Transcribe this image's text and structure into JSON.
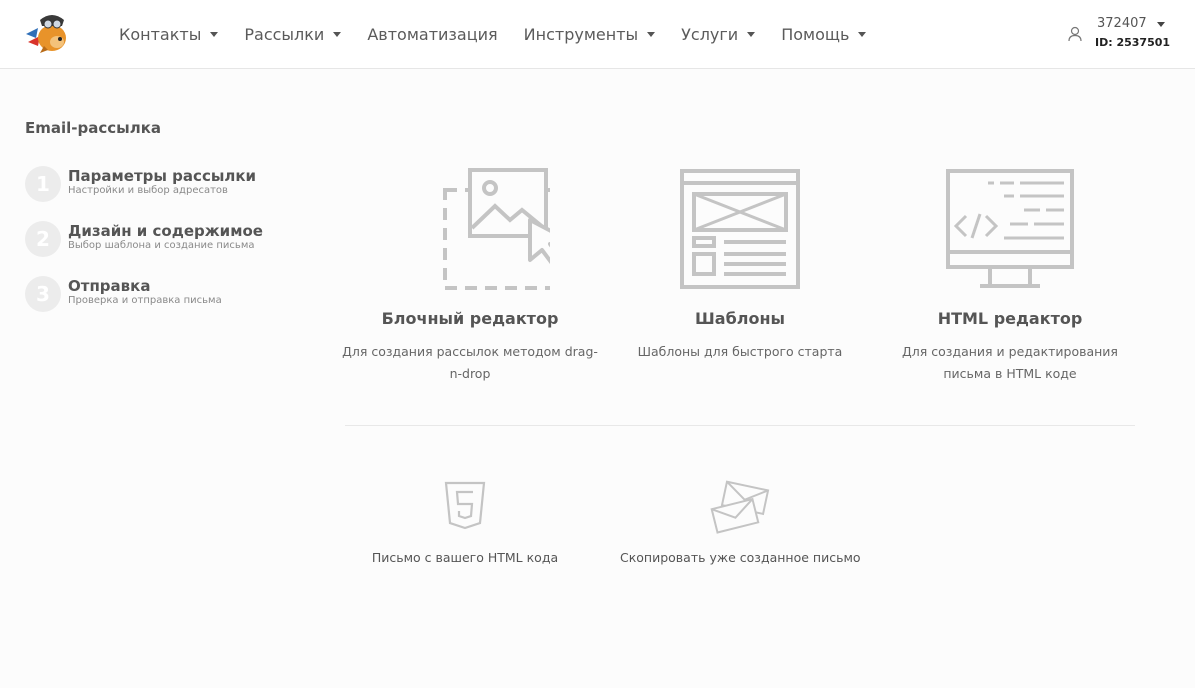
{
  "header": {
    "nav": [
      {
        "label": "Контакты",
        "has_dropdown": true
      },
      {
        "label": "Рассылки",
        "has_dropdown": true
      },
      {
        "label": "Автоматизация",
        "has_dropdown": false
      },
      {
        "label": "Инструменты",
        "has_dropdown": true
      },
      {
        "label": "Услуги",
        "has_dropdown": true
      },
      {
        "label": "Помощь",
        "has_dropdown": true
      }
    ],
    "user": {
      "number": "372407",
      "id": "ID: 2537501"
    }
  },
  "sidebar": {
    "title": "Email-рассылка",
    "steps": [
      {
        "num": "1",
        "title": "Параметры рассылки",
        "subtitle": "Настройки и выбор адресатов"
      },
      {
        "num": "2",
        "title": "Дизайн и содержимое",
        "subtitle": "Выбор шаблона и создание письма"
      },
      {
        "num": "3",
        "title": "Отправка",
        "subtitle": "Проверка и отправка письма"
      }
    ]
  },
  "options": [
    {
      "title": "Блочный редактор",
      "description": "Для создания рассылок методом drag-n-drop",
      "icon": "block-editor-icon"
    },
    {
      "title": "Шаблоны",
      "description": "Шаблоны для быстрого старта",
      "icon": "templates-icon"
    },
    {
      "title": "HTML редактор",
      "description": "Для создания и редактирования письма в HTML коде",
      "icon": "html-editor-icon"
    }
  ],
  "extra_options": [
    {
      "label": "Письмо с вашего HTML кода",
      "icon": "html5-icon"
    },
    {
      "label": "Скопировать уже созданное письмо",
      "icon": "copy-envelopes-icon"
    }
  ],
  "colors": {
    "icon_gray": "#c4c4c4",
    "text": "#555555",
    "step_circle": "#ececec"
  }
}
